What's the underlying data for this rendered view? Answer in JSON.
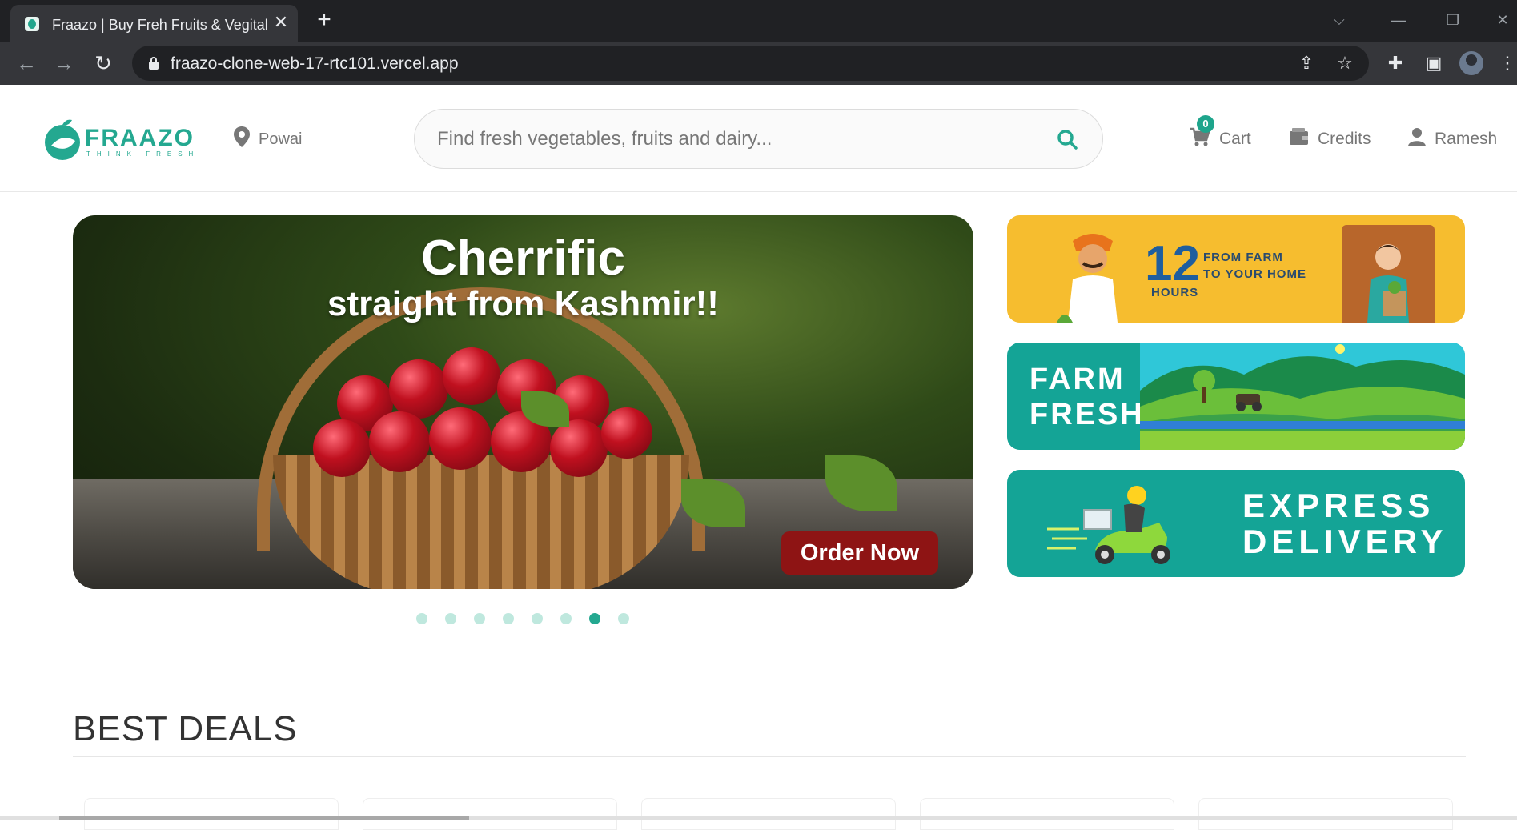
{
  "browser": {
    "tab_title": "Fraazo | Buy Freh Fruits & Vegitables",
    "tab_close": "✕",
    "new_tab": "+",
    "url": "fraazo-clone-web-17-rtc101.vercel.app",
    "window_controls": {
      "tab_search": "⌵",
      "minimize": "—",
      "restore": "❐",
      "close": "✕"
    }
  },
  "header": {
    "logo_text": "FRAAZO",
    "logo_tagline": "THINK FRESH",
    "location": "Powai",
    "search_placeholder": "Find fresh vegetables, fruits and dairy...",
    "cart_label": "Cart",
    "cart_count": "0",
    "credits_label": "Credits",
    "user_name": "Ramesh"
  },
  "hero": {
    "title": "Cherrific",
    "subtitle": "straight from Kashmir!!",
    "cta": "Order Now",
    "slide_count": 8,
    "active_slide": 7
  },
  "banners": {
    "hours": {
      "number": "12",
      "unit": "HOURS",
      "line1": "FROM FARM",
      "line2": "TO YOUR HOME"
    },
    "farm": {
      "line1": "FARM",
      "line2": "FRESH"
    },
    "express": {
      "line1": "EXPRESS",
      "line2": "DELIVERY"
    }
  },
  "deals": {
    "title": "BEST DEALS",
    "card_count": 5
  },
  "colors": {
    "brand": "#24a890",
    "banner_yellow": "#f6bd2f",
    "banner_teal": "#14a496",
    "cta_red": "#8e1414"
  }
}
